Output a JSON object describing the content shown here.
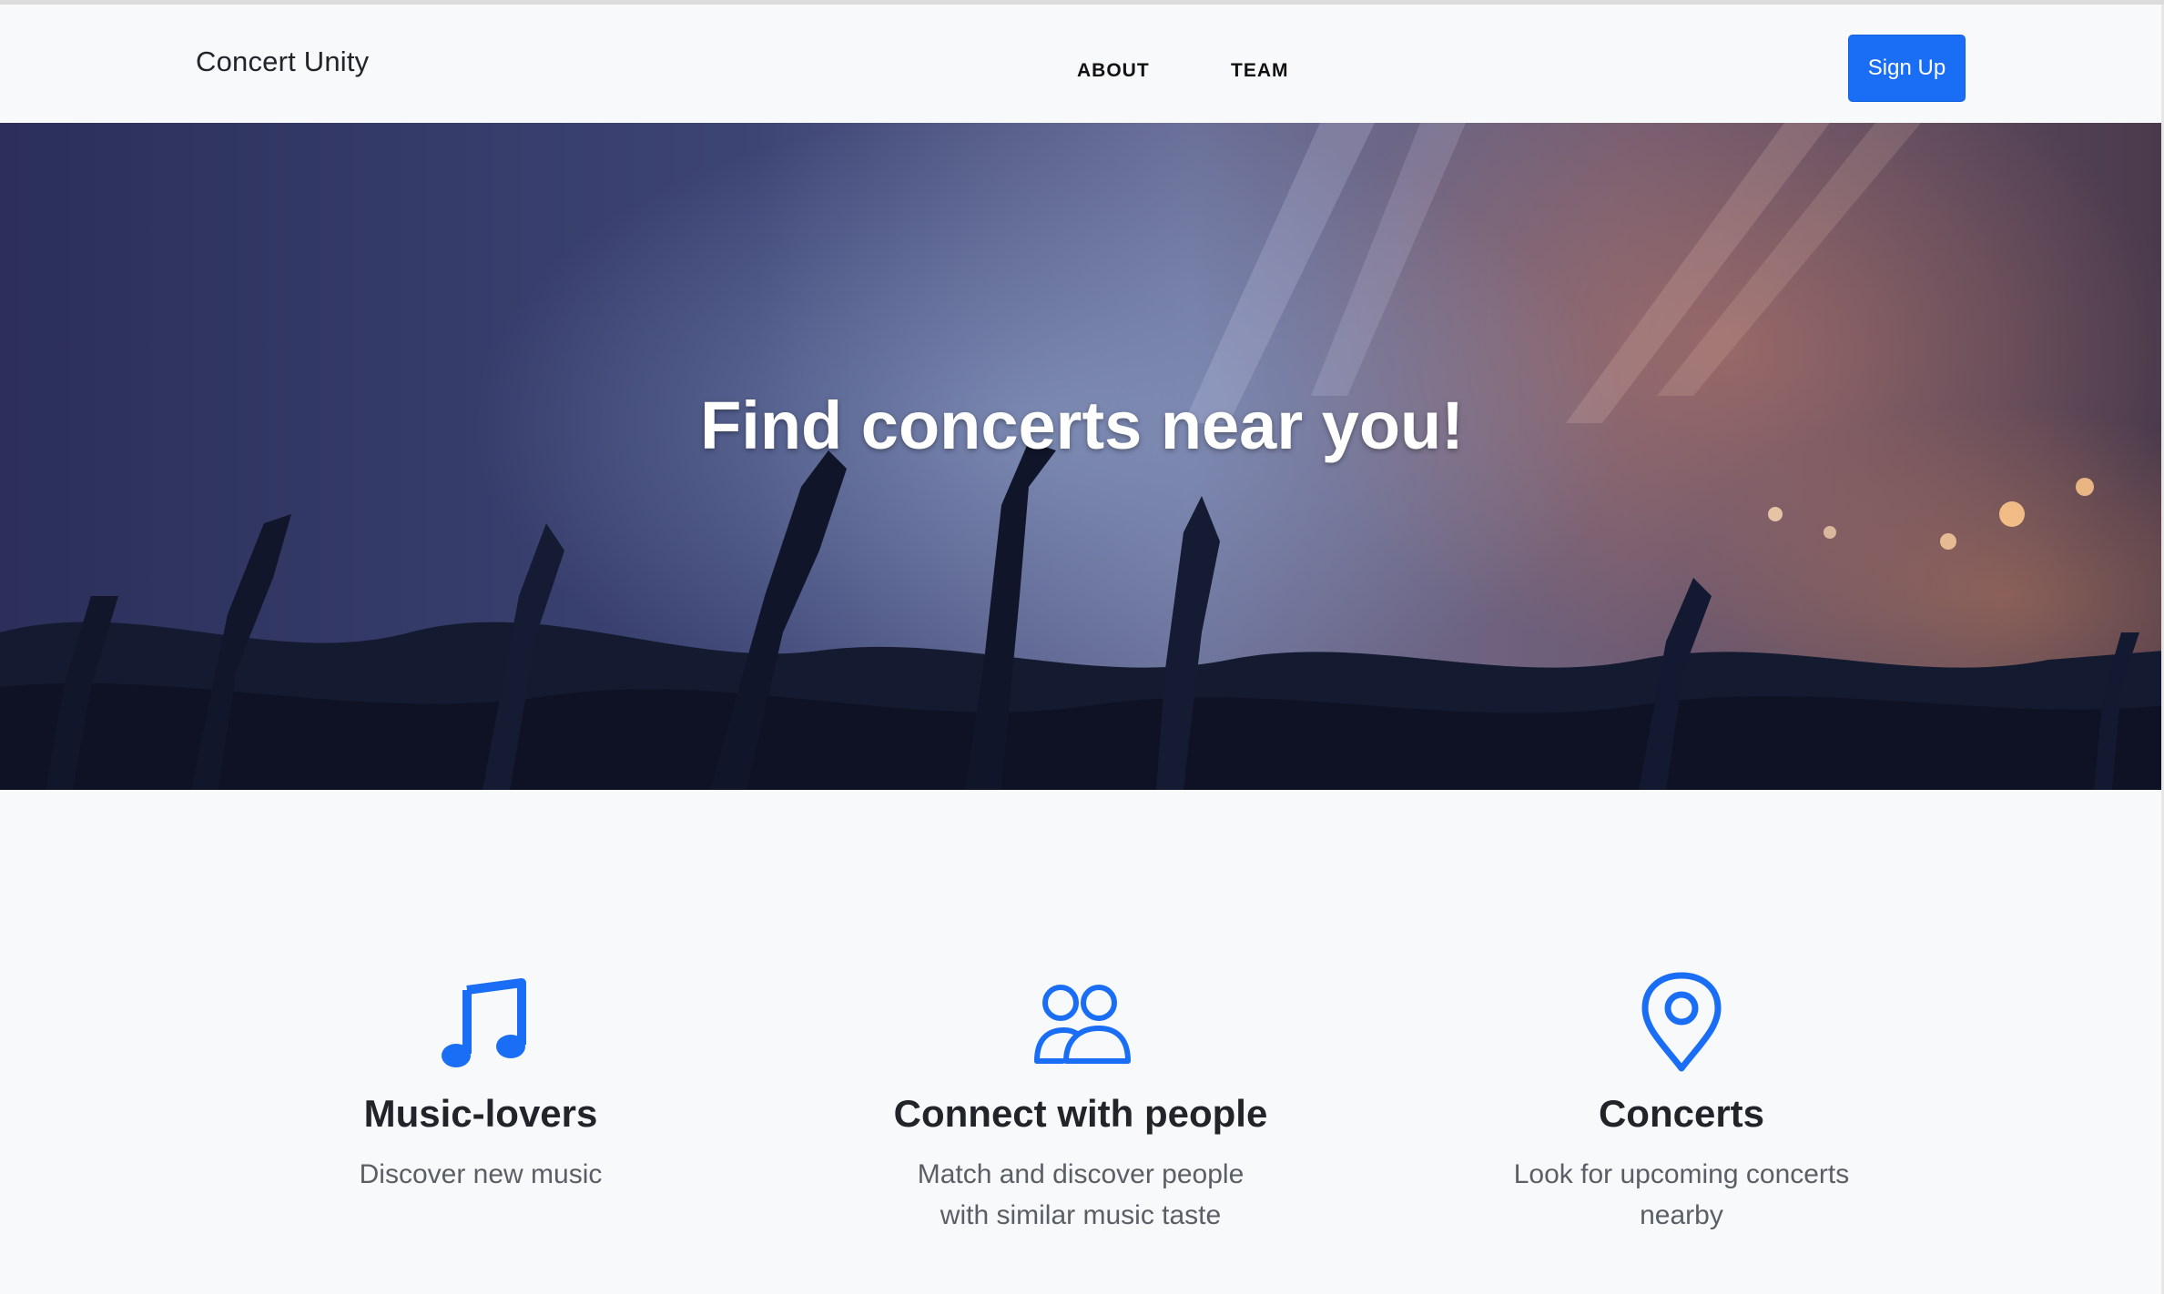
{
  "navbar": {
    "brand": "Concert Unity",
    "links": [
      {
        "label": "ABOUT"
      },
      {
        "label": "TEAM"
      }
    ],
    "signup_label": "Sign Up"
  },
  "hero": {
    "title": "Find concerts near you!"
  },
  "features": [
    {
      "icon": "music-note-icon",
      "title": "Music-lovers",
      "text": "Discover new music"
    },
    {
      "icon": "people-icon",
      "title": "Connect with people",
      "text": "Match and discover people with similar music taste"
    },
    {
      "icon": "map-pin-icon",
      "title": "Concerts",
      "text": "Look for upcoming concerts nearby"
    }
  ],
  "colors": {
    "accent": "#1a6ef5",
    "background": "#f8f9fa",
    "text_dark": "#212529",
    "text_muted": "#5a5f66"
  }
}
